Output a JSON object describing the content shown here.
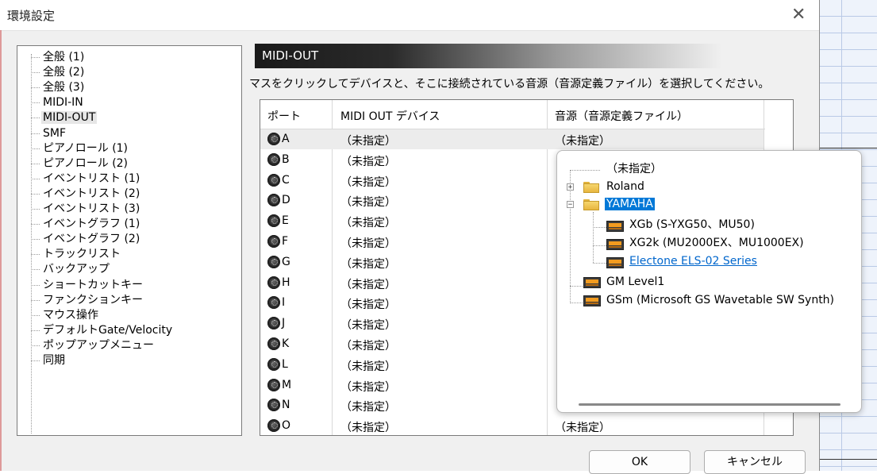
{
  "window": {
    "title": "環境設定",
    "close_glyph": "✕"
  },
  "left_tree": {
    "items": [
      "全般 (1)",
      "全般 (2)",
      "全般 (3)",
      "MIDI-IN",
      "MIDI-OUT",
      "SMF",
      "ピアノロール (1)",
      "ピアノロール (2)",
      "イベントリスト (1)",
      "イベントリスト (2)",
      "イベントリスト (3)",
      "イベントグラフ (1)",
      "イベントグラフ (2)",
      "トラックリスト",
      "バックアップ",
      "ショートカットキー",
      "ファンクションキー",
      "マウス操作",
      "デフォルトGate/Velocity",
      "ポップアップメニュー",
      "同期"
    ],
    "selected_index": 4
  },
  "panel": {
    "header": "MIDI-OUT",
    "instruction": "マスをクリックしてデバイスと、そこに接続されている音源（音源定義ファイル）を選択してください。"
  },
  "grid": {
    "columns": [
      "ポート",
      "MIDI OUT デバイス",
      "音源（音源定義ファイル）"
    ],
    "rows": [
      {
        "port": "A",
        "device": "（未指定）",
        "source": "（未指定）"
      },
      {
        "port": "B",
        "device": "（未指定）",
        "source": ""
      },
      {
        "port": "C",
        "device": "（未指定）",
        "source": ""
      },
      {
        "port": "D",
        "device": "（未指定）",
        "source": ""
      },
      {
        "port": "E",
        "device": "（未指定）",
        "source": ""
      },
      {
        "port": "F",
        "device": "（未指定）",
        "source": ""
      },
      {
        "port": "G",
        "device": "（未指定）",
        "source": ""
      },
      {
        "port": "H",
        "device": "（未指定）",
        "source": ""
      },
      {
        "port": "I",
        "device": "（未指定）",
        "source": ""
      },
      {
        "port": "J",
        "device": "（未指定）",
        "source": ""
      },
      {
        "port": "K",
        "device": "（未指定）",
        "source": ""
      },
      {
        "port": "L",
        "device": "（未指定）",
        "source": ""
      },
      {
        "port": "M",
        "device": "（未指定）",
        "source": ""
      },
      {
        "port": "N",
        "device": "（未指定）",
        "source": ""
      },
      {
        "port": "O",
        "device": "（未指定）",
        "source": "（未指定）"
      }
    ]
  },
  "popup": {
    "unspecified": "（未指定）",
    "roland": "Roland",
    "yamaha": "YAMAHA",
    "xgb": "XGb (S-YXG50、MU50)",
    "xg2k": "XG2k (MU2000EX、MU1000EX)",
    "electone": "Electone ELS-02 Series",
    "gm1": "GM Level1",
    "gsm": "GSm (Microsoft GS Wavetable SW Synth)",
    "expand_glyph": "+",
    "collapse_glyph": "−"
  },
  "buttons": {
    "ok": "OK",
    "cancel": "キャンセル"
  }
}
